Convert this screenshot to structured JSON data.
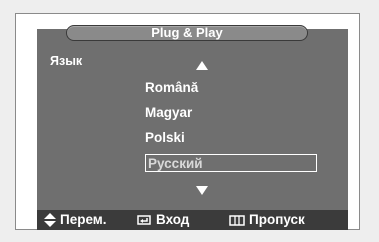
{
  "menu": {
    "title": "Plug & Play",
    "label": "Язык"
  },
  "languages": {
    "items": [
      "Română",
      "Magyar",
      "Polski",
      "Русский"
    ],
    "selected": "Русский"
  },
  "footer": {
    "move_label": "Перем.",
    "enter_label": "Вход",
    "skip_label": "Пропуск"
  },
  "icons": {
    "up": "arrow-up-icon",
    "down": "arrow-down-icon",
    "move": "up-down-arrows-icon",
    "enter": "enter-icon",
    "skip": "skip-icon"
  },
  "colors": {
    "panel": "#6f6f6f",
    "footer": "#3b3b3b",
    "title_bar": "#8a8a8a",
    "text": "#ffffff",
    "selected_text": "#d9d9d9"
  }
}
